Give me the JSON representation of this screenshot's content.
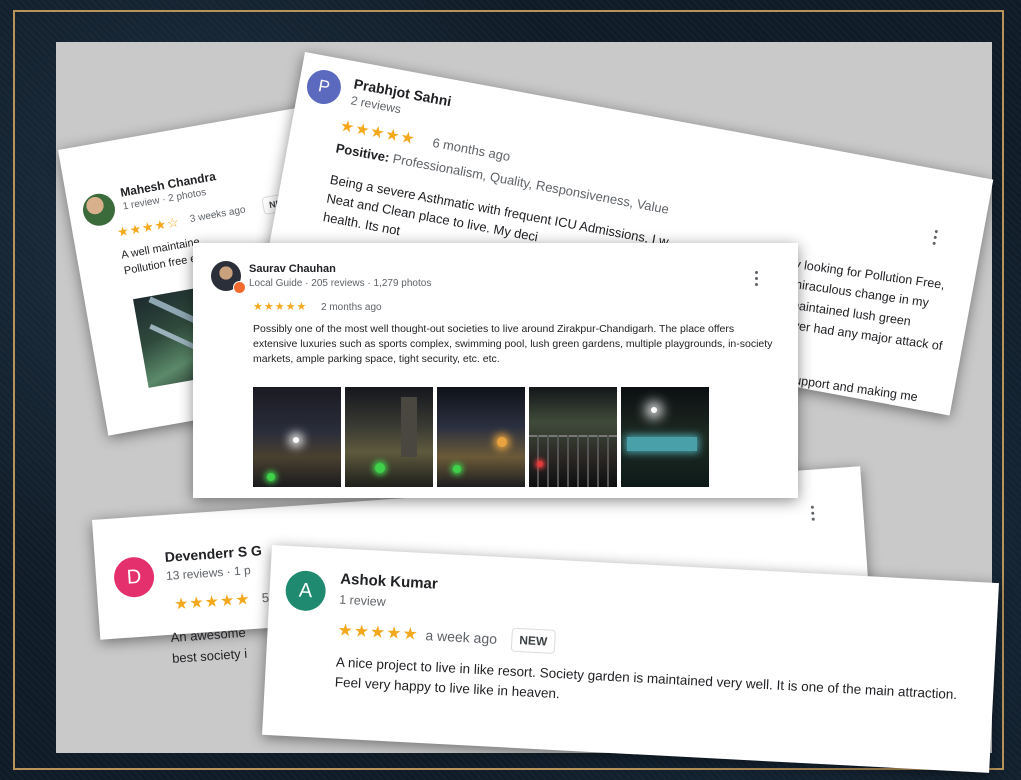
{
  "reviews": {
    "mahesh": {
      "name": "Mahesh Chandra",
      "meta": "1 review · 2 photos",
      "stars": "★★★★☆",
      "ago": "3 weeks ago",
      "badge": "NEW",
      "text_line1": "A well maintaine",
      "text_line2": "Pollution free e"
    },
    "prabhjot": {
      "avatar_letter": "P",
      "avatar_color": "#5b6abf",
      "name": "Prabhjot Sahni",
      "meta": "2 reviews",
      "stars": "★★★★★",
      "ago": "6 months ago",
      "positive_label": "Positive:",
      "positive_text": " Professionalism, Quality, Responsiveness, Value",
      "text_line1": "Being a severe Asthmatic with frequent ICU Admissions, I w",
      "text_line2": "Neat and Clean place to live. My deci",
      "text_line3": "health. Its not",
      "right_line1": "y looking for Pollution Free,",
      "right_line2": "miraculous change in my",
      "right_line3": "maintained lush green",
      "right_line4": "ever had any major attack of",
      "right_line5": "s support and making me"
    },
    "saurav": {
      "name": "Saurav Chauhan",
      "meta": "Local Guide · 205 reviews · 1,279 photos",
      "stars": "★★★★★",
      "ago": "2 months ago",
      "text": "Possibly one of the most well thought-out societies to live around Zirakpur-Chandigarh. The place offers extensive luxuries such as sports complex, swimming pool, lush green gardens, multiple playgrounds, in-society markets, ample parking space, tight security, etc. etc."
    },
    "devenderr": {
      "avatar_letter": "D",
      "avatar_color": "#e4306c",
      "name": "Devenderr S G",
      "meta": "13 reviews · 1 p",
      "stars": "★★★★★",
      "ago": "5",
      "text_line1": "An awesome",
      "text_line2": "best society i"
    },
    "ashok": {
      "avatar_letter": "A",
      "avatar_color": "#1f8a70",
      "name": "Ashok Kumar",
      "meta": "1 review",
      "stars": "★★★★★",
      "ago": "a week ago",
      "badge": "NEW",
      "text": "A nice project to live in like  resort. Society garden is maintained very well. It is  one of the main attraction. Feel very happy to live like in heaven."
    }
  },
  "colors": {
    "star": "#f4a81c",
    "frame_border": "#b8935a",
    "background": "#0f1b26"
  },
  "icons": [
    "kebab-menu-icon",
    "local-guide-badge-icon"
  ]
}
